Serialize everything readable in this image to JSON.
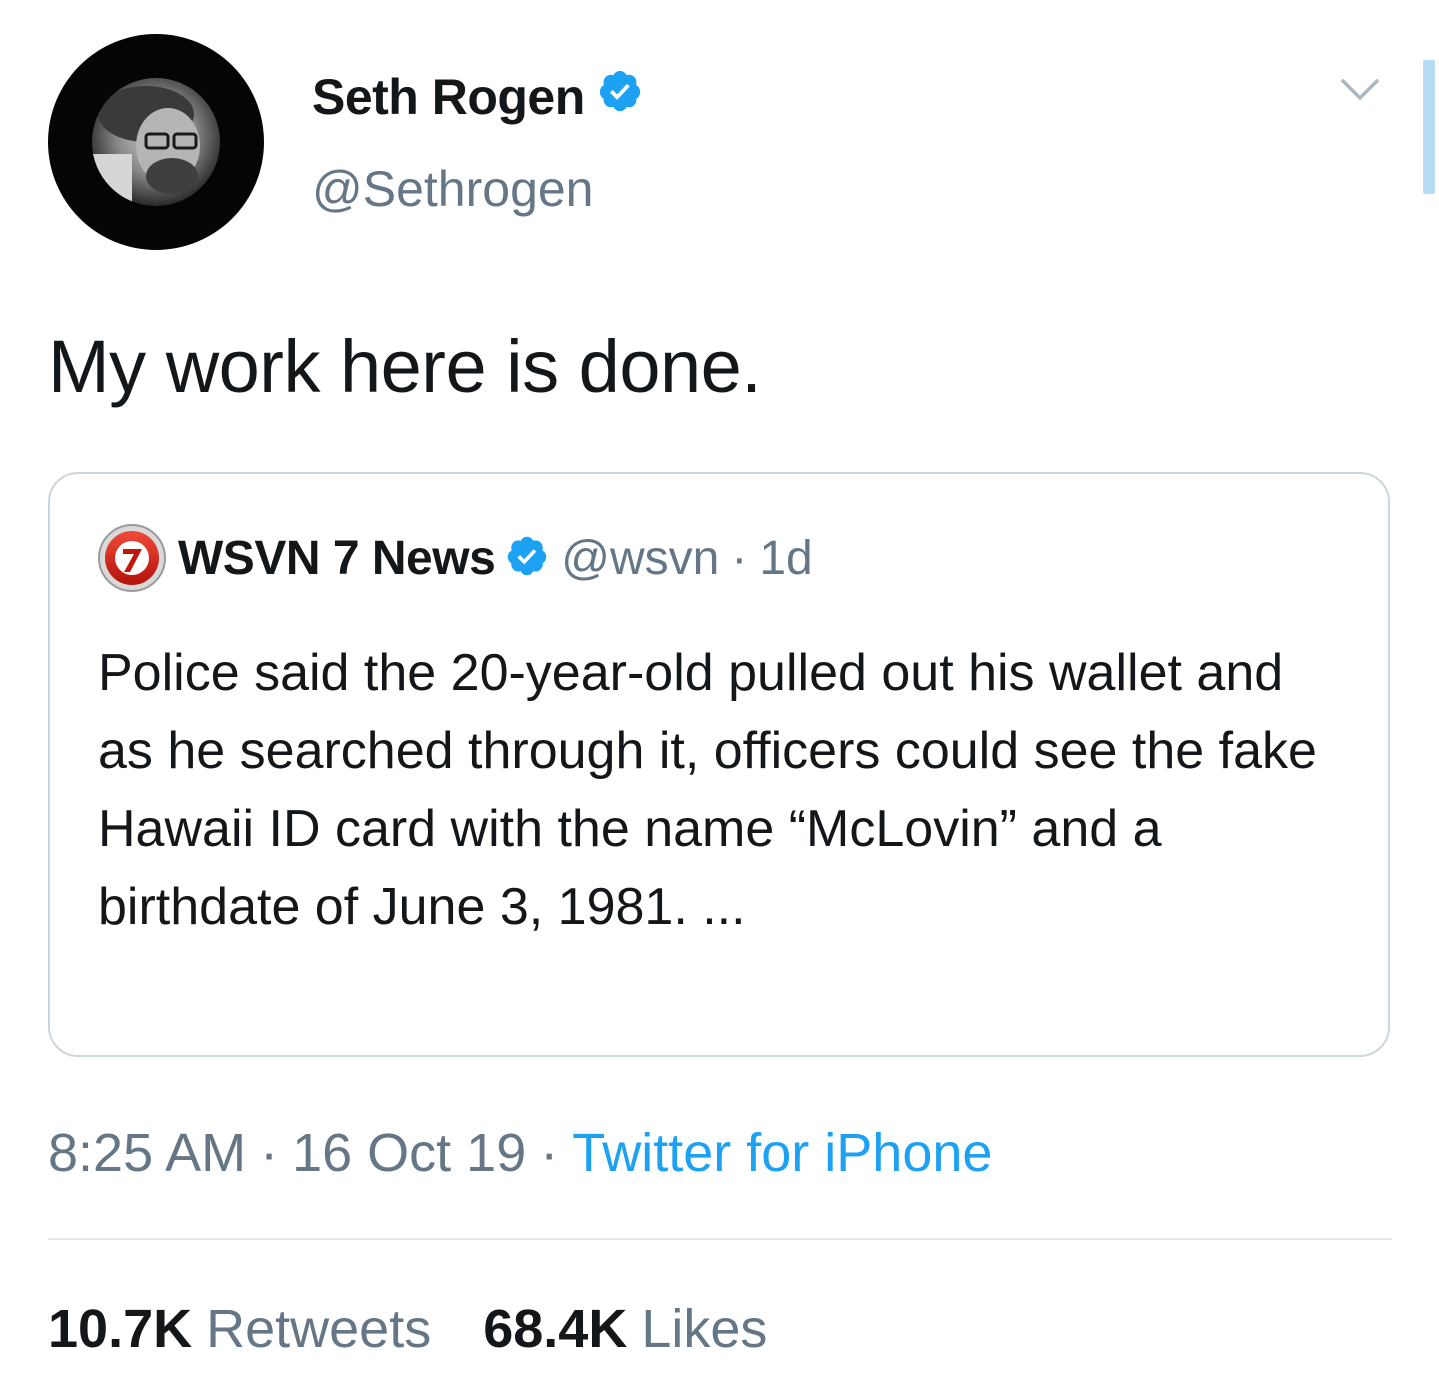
{
  "tweet": {
    "author": {
      "display_name": "Seth Rogen",
      "handle": "@Sethrogen",
      "verified": true
    },
    "text": "My work here is done.",
    "quoted_tweet": {
      "author_name": "WSVN 7 News",
      "handle": "@wsvn",
      "separator": "·",
      "time": "1d",
      "verified": true,
      "text": "Police said the 20-year-old pulled out his wallet and as he searched through it, officers could see the fake Hawaii ID card with the name “McLovin” and a birthdate of June 3, 1981. ..."
    },
    "meta": {
      "time": "8:25 AM",
      "date": "16 Oct 19",
      "separator": "·",
      "source": "Twitter for iPhone"
    },
    "stats": {
      "retweets_count": "10.7K",
      "retweets_label": "Retweets",
      "likes_count": "68.4K",
      "likes_label": "Likes"
    }
  },
  "icons": {
    "verified": "verified-badge-icon",
    "menu": "chevron-down-icon",
    "quote_logo": "wsvn-logo"
  },
  "colors": {
    "verified_blue": "#1da1f2",
    "secondary_text": "#657786",
    "link": "#1da1f2",
    "border": "#ccd6dd",
    "scrollbar": "#b6dcf4"
  }
}
